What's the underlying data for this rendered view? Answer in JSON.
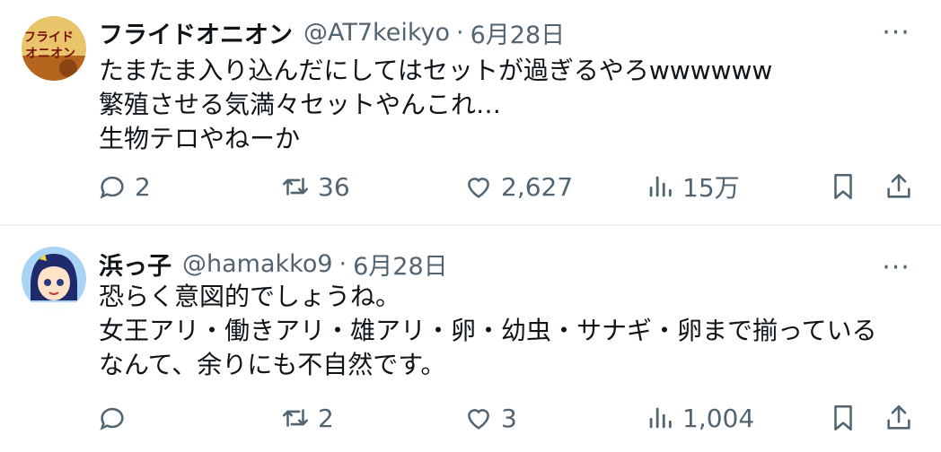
{
  "tweets": [
    {
      "display_name": "フライドオニオン",
      "handle": "@AT7keikyo",
      "separator": "·",
      "date": "6月28日",
      "avatar_text": "フライドオニオン",
      "lines": [
        "たまたま入り込んだにしてはセットが過ぎるやろwwwwww",
        "繁殖させる気満々セットやんこれ…",
        "生物テロやねーか"
      ],
      "stats": {
        "replies": "2",
        "retweets": "36",
        "likes": "2,627",
        "views": "15万"
      }
    },
    {
      "display_name": "浜っ子",
      "handle": "@hamakko9",
      "separator": "·",
      "date": "6月28日",
      "lines": [
        "恐らく意図的でしょうね。",
        "女王アリ・働きアリ・雄アリ・卵・幼虫・サナギ・卵まで揃っている",
        "なんて、余りにも不自然です。"
      ],
      "stats": {
        "replies": "",
        "retweets": "2",
        "likes": "3",
        "views": "1,004"
      }
    }
  ],
  "more_label": "···",
  "colors": {
    "text": "#0f1419",
    "secondary": "#536471",
    "divider": "#eff3f4"
  }
}
